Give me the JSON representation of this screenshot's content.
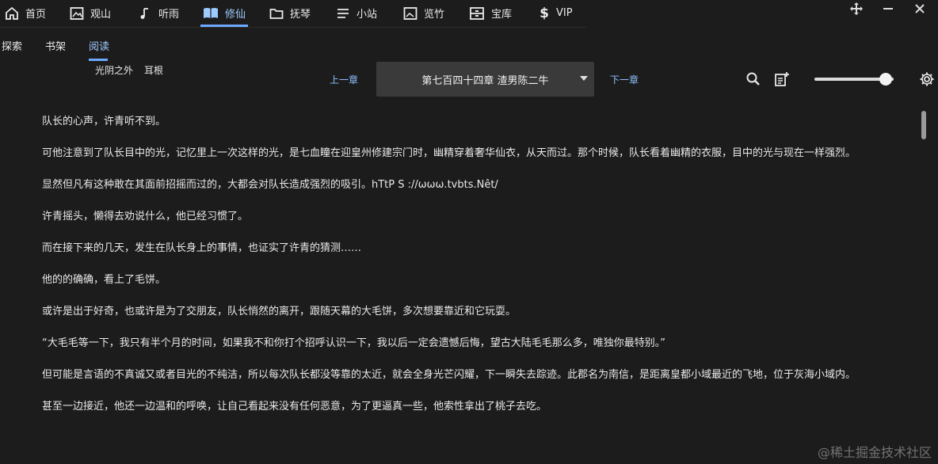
{
  "topnav": {
    "items": [
      {
        "label": "首页",
        "icon": "home-icon"
      },
      {
        "label": "观山",
        "icon": "image-frame-icon"
      },
      {
        "label": "听雨",
        "icon": "music-note-icon"
      },
      {
        "label": "修仙",
        "icon": "open-book-icon",
        "active": true
      },
      {
        "label": "抚琴",
        "icon": "folder-icon"
      },
      {
        "label": "小站",
        "icon": "menu-lines-icon"
      },
      {
        "label": "览竹",
        "icon": "picture-icon"
      },
      {
        "label": "宝库",
        "icon": "archive-icon"
      },
      {
        "label": "VIP",
        "icon": "dollar-icon"
      }
    ]
  },
  "window_controls": [
    "move-icon",
    "minimize-icon",
    "close-icon"
  ],
  "subnav": {
    "tabs": [
      {
        "label": "探索"
      },
      {
        "label": "书架"
      },
      {
        "label": "阅读",
        "active": true
      }
    ]
  },
  "book": {
    "title": "光阴之外",
    "author": "耳根"
  },
  "reader": {
    "prev_label": "上一章",
    "next_label": "下一章",
    "chapter_title": "第七百四十四章 渣男陈二牛",
    "brightness": 0.9
  },
  "content": {
    "paragraphs": [
      "队长的心声，许青听不到。",
      "可他注意到了队长目中的光，记忆里上一次这样的光，是七血瞳在迎皇州修建宗门时，幽精穿着奢华仙衣，从天而过。那个时候，队长看着幽精的衣服，目中的光与现在一样强烈。",
      "显然但凡有这种敢在其面前招摇而过的，大都会对队长造成强烈的吸引。hTtP S ://ωωω.tvbts.Nêt/",
      "许青摇头，懒得去劝说什么，他已经习惯了。",
      "而在接下来的几天，发生在队长身上的事情，也证实了许青的猜测……",
      "他的的确确，看上了毛饼。",
      "或许是出于好奇，也或许是为了交朋友，队长悄然的离开，跟随天幕的大毛饼，多次想要靠近和它玩耍。",
      "“大毛毛等一下，我只有半个月的时间，如果我不和你打个招呼认识一下，我以后一定会遗憾后悔，望古大陆毛毛那么多，唯独你最特别。”",
      "但可能是言语的不真诚又或者目光的不纯洁，所以每次队长都没等靠的太近，就会全身光芒闪耀，下一瞬失去踪迹。此郡名为南信，是距离皇都小域最近的飞地，位于灰海小域内。",
      "甚至一边接近，他还一边温和的呼唤，让自己看起来没有任何恶意，为了更逼真一些，他索性拿出了桃子去吃。"
    ]
  },
  "watermark": "@稀土掘金技术社区"
}
